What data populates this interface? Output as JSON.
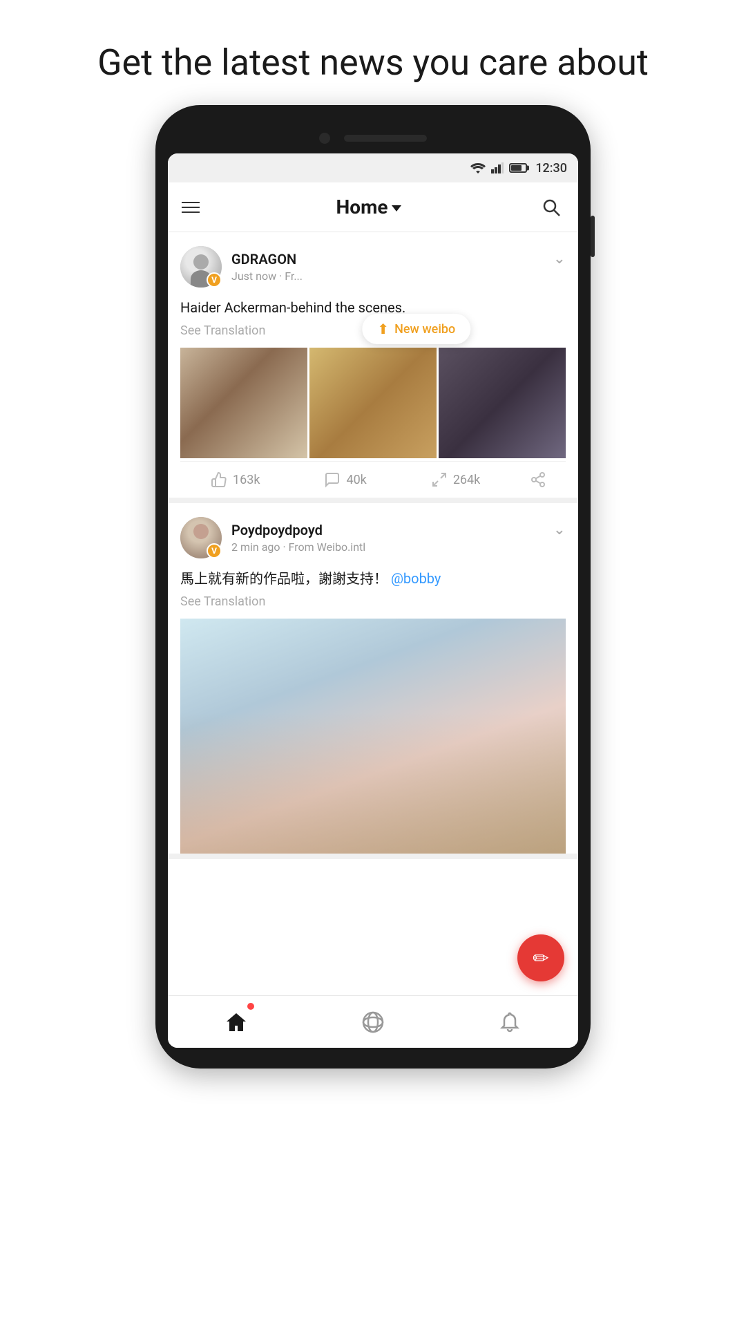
{
  "headline": "Get the latest news you care about",
  "statusBar": {
    "time": "12:30"
  },
  "appHeader": {
    "menuLabel": "menu",
    "title": "Home",
    "searchLabel": "search"
  },
  "newWeiboToast": "New weibo",
  "posts": [
    {
      "id": "post-1",
      "user": {
        "name": "GDRAGON",
        "meta": "Just now · Fr...",
        "verified": true
      },
      "text": "Haider Ackerman-behind the scenes.",
      "seeTranslation": "See Translation",
      "hasPhotos": true,
      "photoCount": 3,
      "likes": "163k",
      "comments": "40k",
      "reposts": "264k"
    },
    {
      "id": "post-2",
      "user": {
        "name": "Poydpoydpoyd",
        "meta": "2 min ago · From Weibo.intl",
        "verified": true
      },
      "text": "馬上就有新的作品啦，謝謝支持！",
      "mention": "@bobby",
      "seeTranslation": "See Translation",
      "hasPhotos": true,
      "photoCount": 1
    }
  ],
  "bottomNav": {
    "home": "home",
    "explore": "explore",
    "notifications": "notifications"
  },
  "fab": {
    "label": "compose"
  }
}
